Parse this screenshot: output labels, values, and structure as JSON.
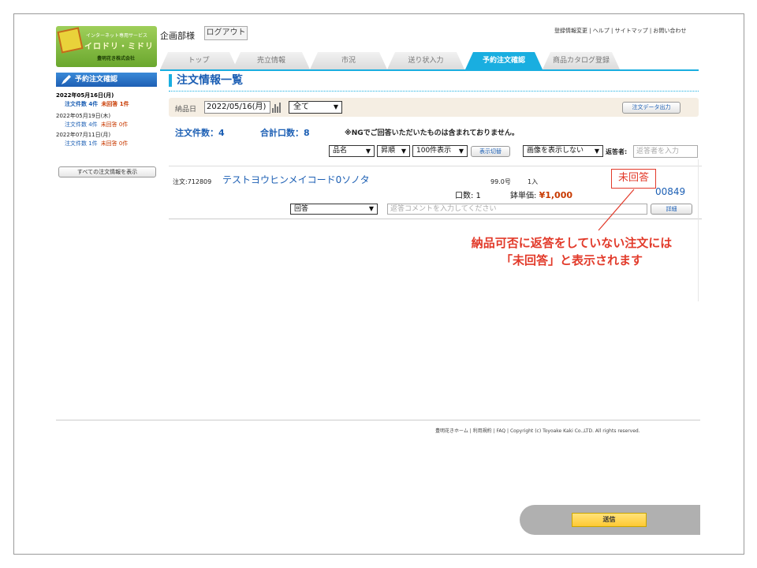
{
  "logo": {
    "tagline": "インターネット専用サービス",
    "name": "イロドリ・ミドリ",
    "company": "豊明花き株式会社"
  },
  "header": {
    "user": "企画部様",
    "logout_label": "ログアウト",
    "top_links": "登録情報変更 | ヘルプ | サイトマップ | お問い合わせ"
  },
  "tabs": [
    {
      "label": "トップ",
      "active": false
    },
    {
      "label": "売立情報",
      "active": false
    },
    {
      "label": "市況",
      "active": false
    },
    {
      "label": "送り状入力",
      "active": false
    },
    {
      "label": "予約注文確認",
      "active": true
    },
    {
      "label": "商品カタログ登録",
      "active": false
    }
  ],
  "sidebar": {
    "heading": "予約注文確認",
    "entries": [
      {
        "date": "2022年05月16日(月)",
        "orders": "注文件数 4件",
        "unanswered": "未回答 1件",
        "bold": true
      },
      {
        "date": "2022年05月19日(木)",
        "orders": "注文件数 4件",
        "unanswered": "未回答 0件",
        "bold": false
      },
      {
        "date": "2022年07月11日(月)",
        "orders": "注文件数 1件",
        "unanswered": "未回答 0件",
        "bold": false
      }
    ],
    "show_all_label": "すべての注文情報を表示"
  },
  "main": {
    "title": "注文情報一覧",
    "delivery_label": "納品日",
    "delivery_date": "2022/05/16(月)",
    "filter_value": "全て",
    "export_label": "注文データ出力",
    "order_count": "注文件数：4",
    "total_units": "合計口数：8",
    "note": "※NGでご回答いただいたものは含まれておりません。",
    "sort_field": "品名",
    "sort_order": "昇順",
    "page_size": "100件表示",
    "toggle_label": "表示切替",
    "image_option": "画像を表示しない",
    "responder_label": "返答者:",
    "responder_placeholder": "返答者を入力"
  },
  "order": {
    "order_no": "注文:712809",
    "product": "テストヨウヒンメイコード0ソノタ",
    "size": "99.0号",
    "qty_in": "1入",
    "status": "未回答",
    "units": "口数: 1",
    "price_label": "鉢単価:",
    "price": "¥1,000",
    "code": "00849",
    "answer_value": "回答",
    "comment_placeholder": "返答コメントを入力してください",
    "detail_label": "詳細"
  },
  "callout": {
    "line1": "納品可否に返答をしていない注文には",
    "line2": "「未回答」と表示されます",
    "color": "#e23a2a"
  },
  "footer": {
    "links": "豊明花きホーム | 利用規約 | FAQ",
    "copyright": "Copyright (c) Toyoake Kaki Co.,LTD. All rights reserved."
  },
  "send_label": "送信",
  "colors": {
    "accent": "#19aee0",
    "link": "#1c5fb4",
    "alert": "#e23a2a"
  }
}
